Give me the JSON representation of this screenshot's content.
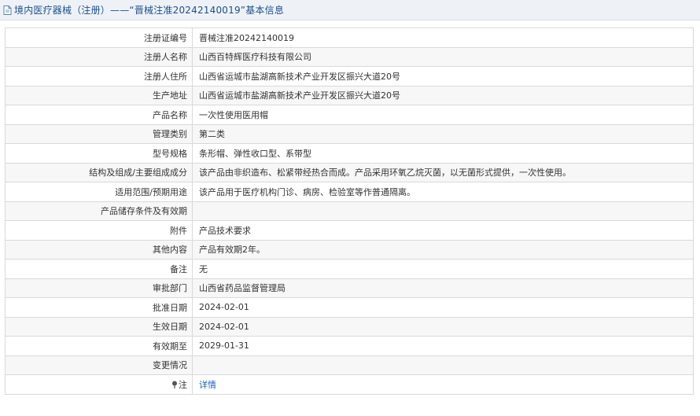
{
  "header": {
    "title": "境内医疗器械（注册）——“晋械注准20242140019”基本信息"
  },
  "rows": [
    {
      "label": "注册证编号",
      "value": "晋械注准20242140019"
    },
    {
      "label": "注册人名称",
      "value": "山西百特辉医疗科技有限公司"
    },
    {
      "label": "注册人住所",
      "value": "山西省运城市盐湖高新技术产业开发区振兴大道20号"
    },
    {
      "label": "生产地址",
      "value": "山西省运城市盐湖高新技术产业开发区振兴大道20号"
    },
    {
      "label": "产品名称",
      "value": "一次性使用医用帽"
    },
    {
      "label": "管理类别",
      "value": "第二类"
    },
    {
      "label": "型号规格",
      "value": "条形帽、弹性收口型、系带型"
    },
    {
      "label": "结构及组成/主要组成成分",
      "value": "该产品由非织造布、松紧带经热合而成。产品采用环氧乙烷灭菌，以无菌形式提供，一次性使用。"
    },
    {
      "label": "适用范围/预期用途",
      "value": "该产品用于医疗机构门诊、病房、检验室等作普通隔离。"
    },
    {
      "label": "产品储存条件及有效期",
      "value": ""
    },
    {
      "label": "附件",
      "value": "产品技术要求"
    },
    {
      "label": "其他内容",
      "value": "产品有效期2年。"
    },
    {
      "label": "备注",
      "value": "无"
    },
    {
      "label": "审批部门",
      "value": "山西省药品监督管理局"
    },
    {
      "label": "批准日期",
      "value": "2024-02-01"
    },
    {
      "label": "生效日期",
      "value": "2024-02-01"
    },
    {
      "label": "有效期至",
      "value": "2029-01-31"
    },
    {
      "label": "变更情况",
      "value": ""
    }
  ],
  "note_row": {
    "label": "注",
    "link": "详情"
  },
  "icons": {
    "title": "document-icon",
    "note": "pin-icon"
  },
  "colors": {
    "title_text": "#1f4e8c",
    "link": "#1f5fbf",
    "header_bg": "#eef2f7"
  }
}
